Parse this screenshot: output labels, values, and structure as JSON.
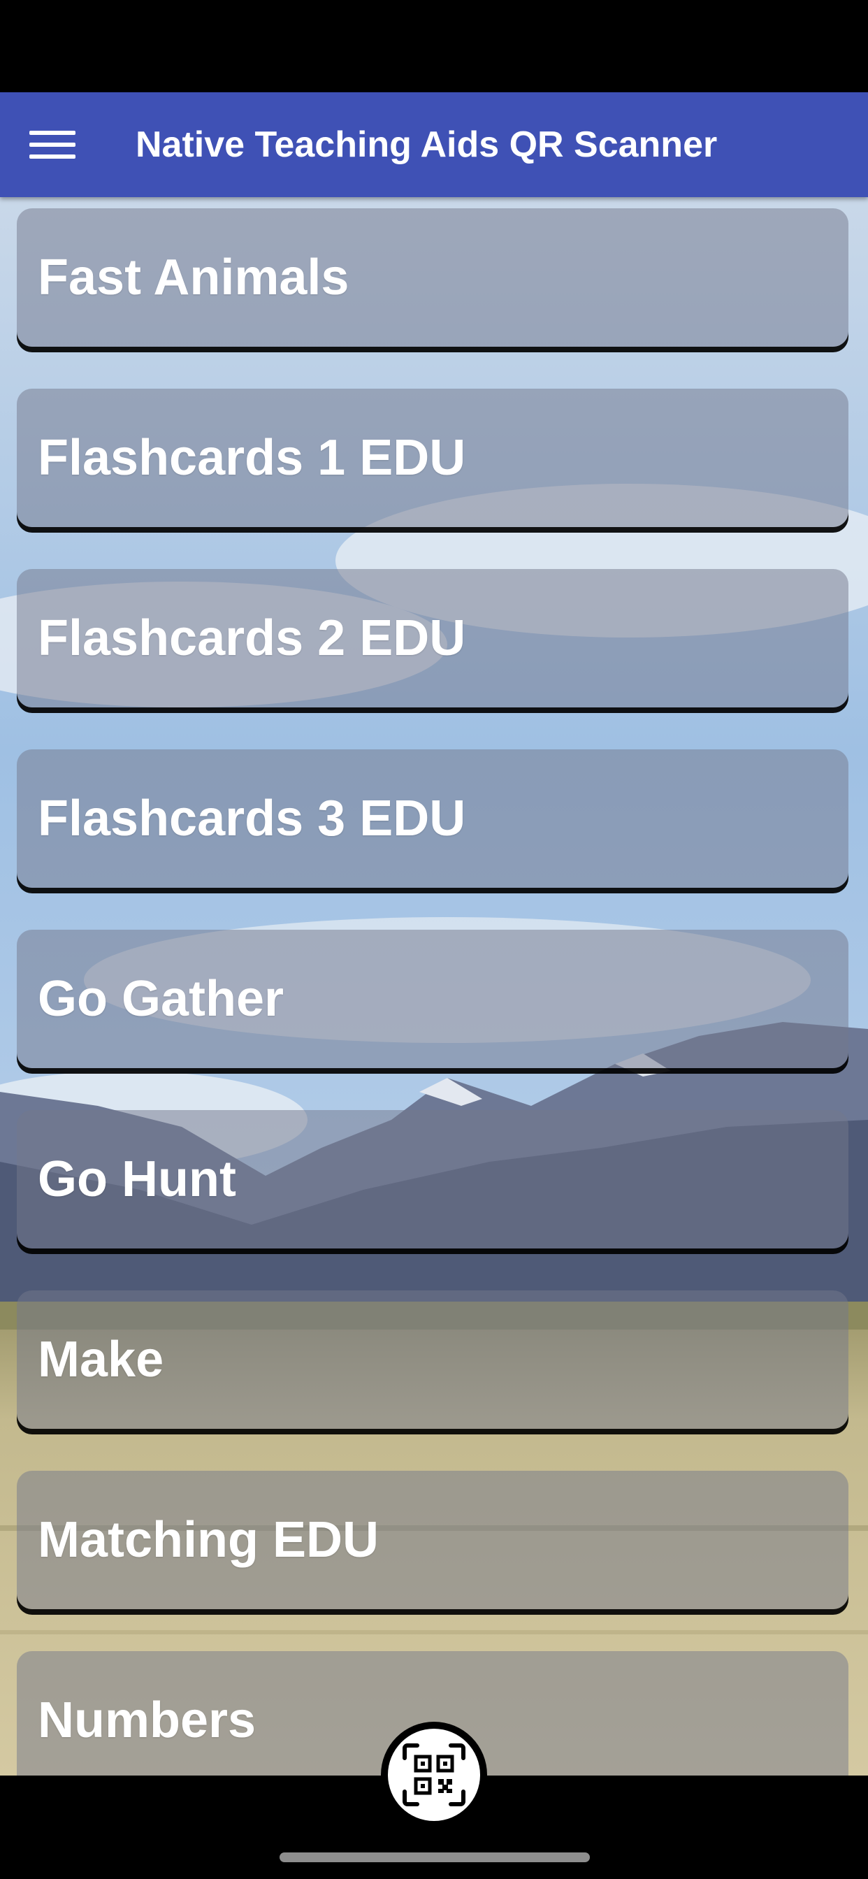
{
  "app_bar": {
    "title": "Native Teaching Aids QR Scanner",
    "menu_icon": "hamburger-menu-icon",
    "color": "#3f51b5"
  },
  "list": {
    "items": [
      {
        "label": "Fast Animals"
      },
      {
        "label": "Flashcards 1 EDU"
      },
      {
        "label": "Flashcards 2 EDU"
      },
      {
        "label": "Flashcards 3 EDU"
      },
      {
        "label": "Go Gather"
      },
      {
        "label": "Go Hunt"
      },
      {
        "label": "Make"
      },
      {
        "label": "Matching EDU"
      },
      {
        "label": "Numbers"
      }
    ]
  },
  "scan_button": {
    "icon": "qr-code-scan-icon"
  },
  "background": {
    "scene": "mountain-landscape",
    "sky_color": "#aecbe6",
    "mountain_color": "#4e5a74",
    "field_color": "#b8ae82"
  }
}
